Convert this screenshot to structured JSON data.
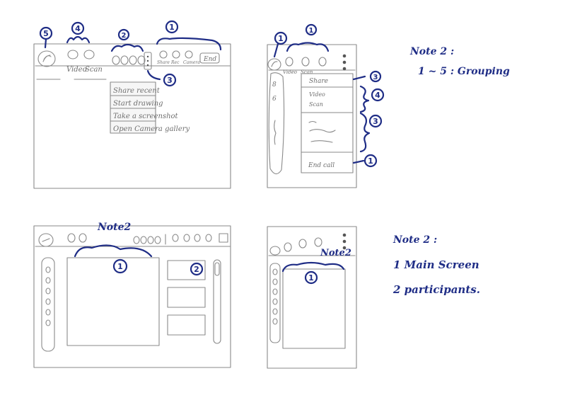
{
  "sketch1": {
    "markers": [
      "5",
      "4",
      "2",
      "1",
      "3"
    ],
    "tabs": [
      "Video",
      "Scan"
    ],
    "right_labels": [
      "Share",
      "Rec",
      "Camera"
    ],
    "end_button": "End",
    "menu_items": [
      "Share recent",
      "Start drawing",
      "Take a screenshot",
      "Open Camera gallery"
    ]
  },
  "sketch2": {
    "markers": [
      "1",
      "1",
      "3",
      "4",
      "3",
      "1"
    ],
    "tabs": [
      "Video",
      "Scan"
    ],
    "sidebar_chars": [
      "8",
      "6"
    ],
    "panel_items": [
      "Share",
      "Video",
      "Scan",
      "End call"
    ]
  },
  "note_top": {
    "title": "Note 2 :",
    "body": "1 ~ 5 : Grouping"
  },
  "sketch3": {
    "label": "Note2",
    "markers": [
      "1",
      "2"
    ]
  },
  "sketch4": {
    "label": "Note2",
    "markers": [
      "1"
    ]
  },
  "note_bottom": {
    "title": "Note 2 :",
    "items": [
      "1 Main Screen",
      "2 participants."
    ]
  }
}
